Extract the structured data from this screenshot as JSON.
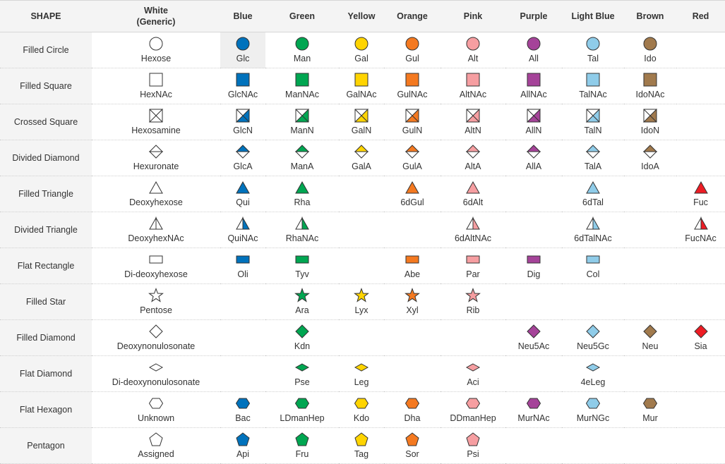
{
  "headers": [
    "SHAPE",
    "White\n(Generic)",
    "Blue",
    "Green",
    "Yellow",
    "Orange",
    "Pink",
    "Purple",
    "Light Blue",
    "Brown",
    "Red"
  ],
  "colors": {
    "White": "#ffffff",
    "Blue": "#0072bc",
    "Green": "#00a651",
    "Yellow": "#ffd400",
    "Orange": "#f47920",
    "Pink": "#f69ea1",
    "Purple": "#a54399",
    "LightBlue": "#8fcce9",
    "Brown": "#a17a4d",
    "Red": "#ed1c24"
  },
  "rows": [
    {
      "shape": "Filled Circle",
      "icon": "circle",
      "cells": [
        "Hexose",
        "Glc",
        "Man",
        "Gal",
        "Gul",
        "Alt",
        "All",
        "Tal",
        "Ido",
        ""
      ]
    },
    {
      "shape": "Filled Square",
      "icon": "square",
      "cells": [
        "HexNAc",
        "GlcNAc",
        "ManNAc",
        "GalNAc",
        "GulNAc",
        "AltNAc",
        "AllNAc",
        "TalNAc",
        "IdoNAc",
        ""
      ]
    },
    {
      "shape": "Crossed Square",
      "icon": "crossed-square",
      "cells": [
        "Hexosamine",
        "GlcN",
        "ManN",
        "GalN",
        "GulN",
        "AltN",
        "AllN",
        "TalN",
        "IdoN",
        ""
      ]
    },
    {
      "shape": "Divided Diamond",
      "icon": "divided-diamond",
      "cells": [
        "Hexuronate",
        "GlcA",
        "ManA",
        "GalA",
        "GulA",
        "AltA",
        "AllA",
        "TalA",
        "IdoA",
        ""
      ]
    },
    {
      "shape": "Filled Triangle",
      "icon": "triangle",
      "cells": [
        "Deoxyhexose",
        "Qui",
        "Rha",
        "",
        "6dGul",
        "6dAlt",
        "",
        "6dTal",
        "",
        "Fuc"
      ]
    },
    {
      "shape": "Divided Triangle",
      "icon": "divided-triangle",
      "cells": [
        "DeoxyhexNAc",
        "QuiNAc",
        "RhaNAc",
        "",
        "",
        "6dAltNAc",
        "",
        "6dTalNAc",
        "",
        "FucNAc"
      ]
    },
    {
      "shape": "Flat Rectangle",
      "icon": "flat-rectangle",
      "cells": [
        "Di-deoxyhexose",
        "Oli",
        "Tyv",
        "",
        "Abe",
        "Par",
        "Dig",
        "Col",
        "",
        ""
      ]
    },
    {
      "shape": "Filled Star",
      "icon": "star",
      "cells": [
        "Pentose",
        "",
        "Ara",
        "Lyx",
        "Xyl",
        "Rib",
        "",
        "",
        "",
        ""
      ]
    },
    {
      "shape": "Filled Diamond",
      "icon": "diamond",
      "cells": [
        "Deoxynonulosonate",
        "",
        "Kdn",
        "",
        "",
        "",
        "Neu5Ac",
        "Neu5Gc",
        "Neu",
        "Sia"
      ]
    },
    {
      "shape": "Flat Diamond",
      "icon": "flat-diamond",
      "cells": [
        "Di-deoxynonulosonate",
        "",
        "Pse",
        "Leg",
        "",
        "Aci",
        "",
        "4eLeg",
        "",
        ""
      ]
    },
    {
      "shape": "Flat Hexagon",
      "icon": "hexagon",
      "cells": [
        "Unknown",
        "Bac",
        "LDmanHep",
        "Kdo",
        "Dha",
        "DDmanHep",
        "MurNAc",
        "MurNGc",
        "Mur",
        ""
      ]
    },
    {
      "shape": "Pentagon",
      "icon": "pentagon",
      "cells": [
        "Assigned",
        "Api",
        "Fru",
        "Tag",
        "Sor",
        "Psi",
        "",
        "",
        "",
        ""
      ]
    }
  ]
}
